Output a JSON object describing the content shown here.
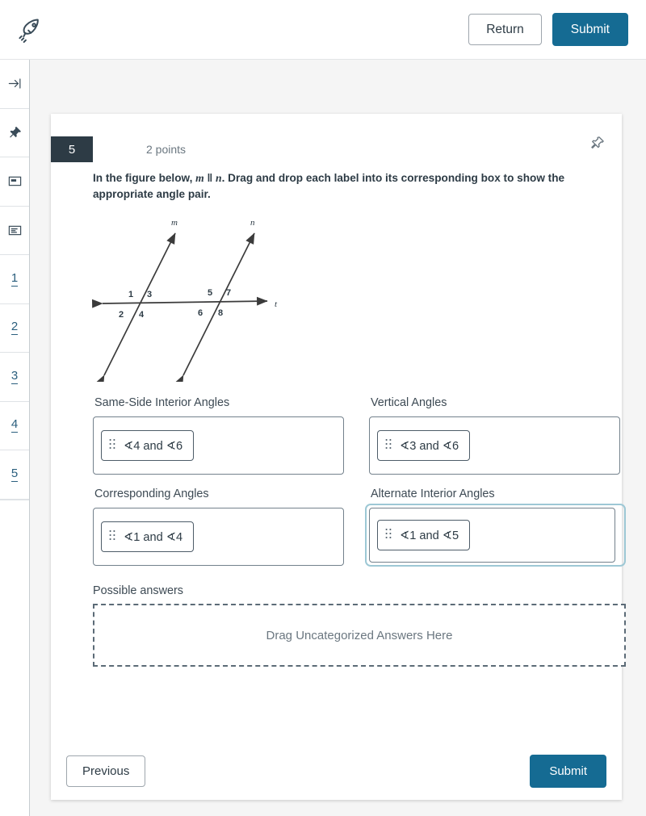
{
  "topbar": {
    "logo_icon": "rocket-icon",
    "return_label": "Return",
    "submit_label": "Submit"
  },
  "sidebar": {
    "icons": [
      {
        "name": "collapse-arrow-icon"
      },
      {
        "name": "pin-icon"
      },
      {
        "name": "note-card-icon"
      },
      {
        "name": "list-lines-icon"
      }
    ],
    "question_numbers": [
      "1",
      "2",
      "3",
      "4",
      "5"
    ]
  },
  "question": {
    "number": "5",
    "points": "2 points",
    "pin_icon": "pushpin-icon",
    "prompt_part1": "In the figure below,",
    "prompt_m": "m",
    "prompt_parallel": "‖",
    "prompt_n": "n",
    "prompt_part2": ". Drag and drop each label into its corresponding box to show the appropriate angle pair."
  },
  "figure": {
    "line_m_label": "m",
    "line_n_label": "n",
    "line_t_label": "t",
    "angle_labels": [
      "1",
      "3",
      "2",
      "4",
      "5",
      "7",
      "6",
      "8"
    ]
  },
  "zones": [
    {
      "label": "Same-Side Interior Angles",
      "chip": "∢4 and ∢6",
      "focused": false
    },
    {
      "label": "Vertical Angles",
      "chip": "∢3 and ∢6",
      "focused": false
    },
    {
      "label": "Corresponding Angles",
      "chip": "∢1 and ∢4",
      "focused": false
    },
    {
      "label": "Alternate Interior Angles",
      "chip": "∢1 and ∢5",
      "focused": true
    }
  ],
  "possible_answers": {
    "label": "Possible answers",
    "dropzone_text": "Drag Uncategorized Answers Here"
  },
  "footer": {
    "previous_label": "Previous",
    "submit_label": "Submit"
  },
  "colors": {
    "primary": "#156b93",
    "badge_dark": "#2d3b45",
    "focus_ring": "#9dc8d5",
    "rail_link": "#2b5f7e"
  }
}
